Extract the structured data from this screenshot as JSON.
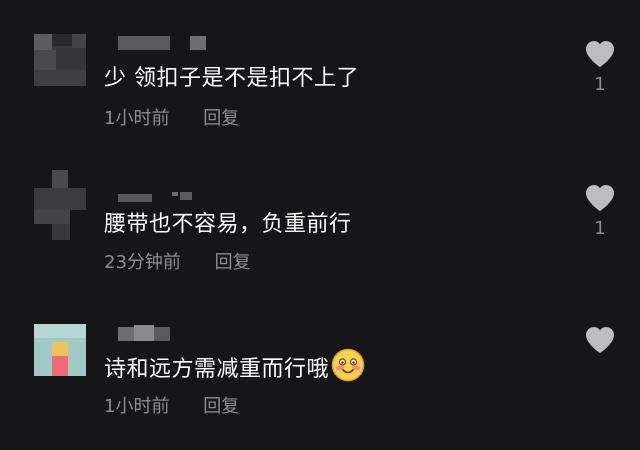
{
  "comments": [
    {
      "text": "少 领扣子是不是扣不上了",
      "time": "1小时前",
      "reply_label": "回复",
      "likes": "1"
    },
    {
      "text": "腰带也不容易，负重前行",
      "time": "23分钟前",
      "reply_label": "回复",
      "likes": "1"
    },
    {
      "text": "诗和远方需减重而行哦",
      "time": "1小时前",
      "reply_label": "回复",
      "likes": "",
      "emoji": "smiling-blush-emoji"
    }
  ],
  "colors": {
    "background": "#161618",
    "text": "#ffffff",
    "meta": "#8d8d92",
    "heart": "#bdbdc1"
  }
}
